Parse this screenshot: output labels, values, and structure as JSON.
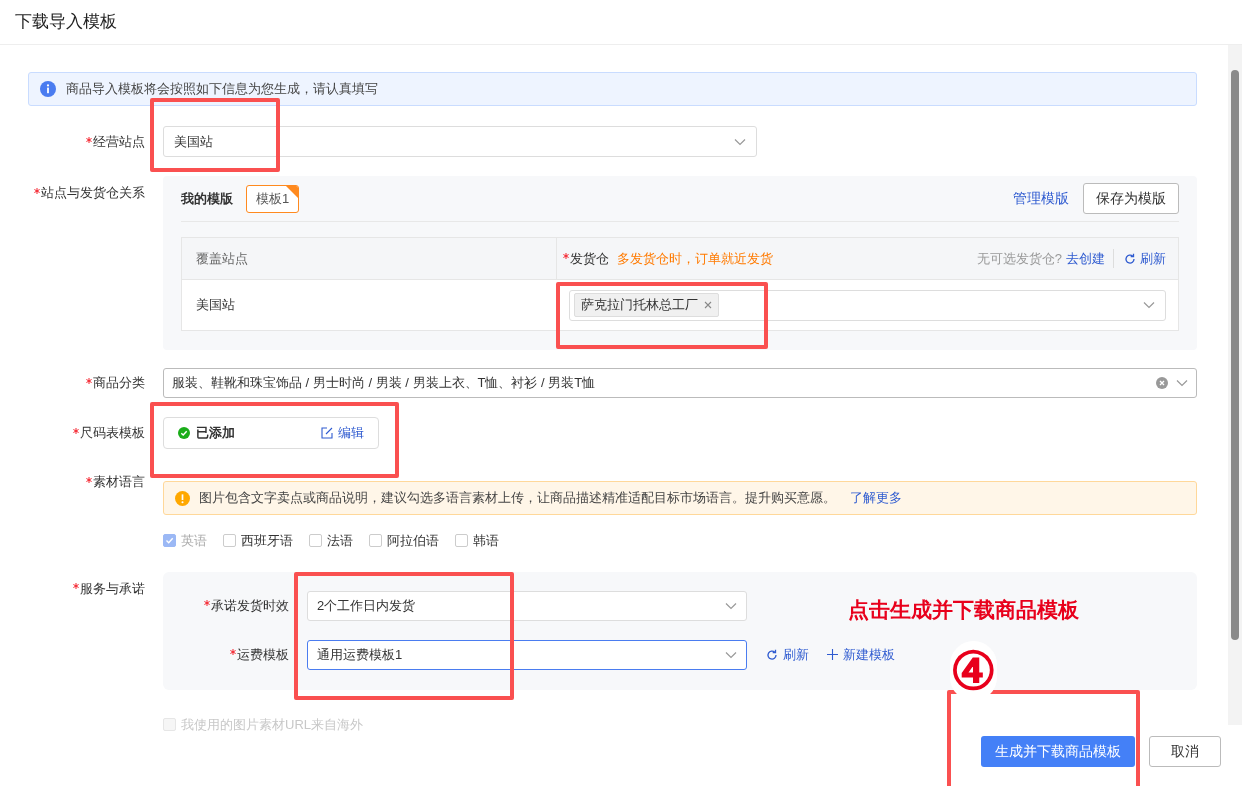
{
  "dialog_title": "下载导入模板",
  "info_notice": "商品导入模板将会按照如下信息为您生成，请认真填写",
  "site": {
    "label": "经营站点",
    "required": true,
    "value": "美国站"
  },
  "warehouse_relation": {
    "label": "站点与发货仓关系",
    "required": true,
    "my_templates_label": "我的模版",
    "templates": [
      {
        "label": "模板1",
        "selected": true
      }
    ],
    "manage_link": "管理模版",
    "save_button": "保存为模版",
    "table": {
      "site_column": "覆盖站点",
      "warehouse_column": "发货仓",
      "warehouse_required": true,
      "warehouse_hint": "多发货仓时，订单就近发货",
      "no_warehouse_text": "无可选发货仓?",
      "create_link": "去创建",
      "refresh_link": "刷新",
      "rows": [
        {
          "site": "美国站",
          "warehouses": [
            "萨克拉门托林总工厂"
          ]
        }
      ]
    }
  },
  "category": {
    "label": "商品分类",
    "required": true,
    "value": "服装、鞋靴和珠宝饰品 / 男士时尚 / 男装 / 男装上衣、T恤、衬衫 / 男装T恤"
  },
  "size_chart": {
    "label": "尺码表模板",
    "required": true,
    "status": "已添加",
    "edit_link": "编辑"
  },
  "material_language": {
    "label": "素材语言",
    "required": true,
    "warning": "图片包含文字卖点或商品说明，建议勾选多语言素材上传，让商品描述精准适配目标市场语言。提升购买意愿。",
    "learn_more": "了解更多",
    "options": [
      {
        "label": "英语",
        "checked": true,
        "disabled": true
      },
      {
        "label": "西班牙语",
        "checked": false,
        "disabled": false
      },
      {
        "label": "法语",
        "checked": false,
        "disabled": false
      },
      {
        "label": "阿拉伯语",
        "checked": false,
        "disabled": false
      },
      {
        "label": "韩语",
        "checked": false,
        "disabled": false
      }
    ]
  },
  "service": {
    "label": "服务与承诺",
    "required": true,
    "fields": [
      {
        "label": "承诺发货时效",
        "required": true,
        "value": "2个工作日内发货",
        "focused": false
      },
      {
        "label": "运费模板",
        "required": true,
        "value": "通用运费模板1",
        "focused": true
      }
    ],
    "refresh_link": "刷新",
    "new_template_link": "新建模板"
  },
  "overseas_images": {
    "label": "我使用的图片素材URL来自海外",
    "checked": false,
    "disabled": true
  },
  "buttons": [
    {
      "label": "生成并下载商品模板",
      "kind": "primary"
    },
    {
      "label": "取消",
      "kind": "default"
    }
  ],
  "annotation": {
    "caption": "点击生成并下载商品模板",
    "step": "④"
  }
}
